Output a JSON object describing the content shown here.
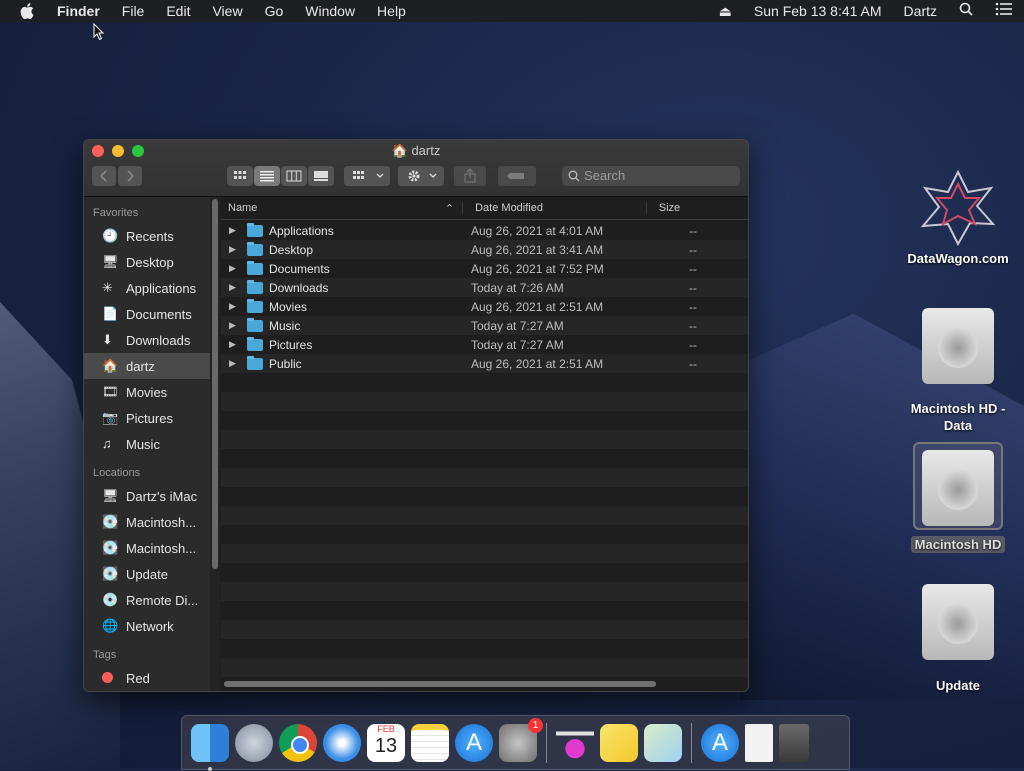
{
  "menubar": {
    "app_name": "Finder",
    "menus": [
      "File",
      "Edit",
      "View",
      "Go",
      "Window",
      "Help"
    ],
    "datetime": "Sun Feb 13  8:41 AM",
    "user": "Dartz"
  },
  "window": {
    "title": "dartz",
    "search_placeholder": "Search",
    "sidebar": {
      "favorites_heading": "Favorites",
      "favorites": [
        "Recents",
        "Desktop",
        "Applications",
        "Documents",
        "Downloads",
        "dartz",
        "Movies",
        "Pictures",
        "Music"
      ],
      "locations_heading": "Locations",
      "locations": [
        "Dartz's iMac",
        "Macintosh...",
        "Macintosh...",
        "Update",
        "Remote Di...",
        "Network"
      ],
      "tags_heading": "Tags",
      "tags": [
        "Red"
      ]
    },
    "columns": {
      "name": "Name",
      "date": "Date Modified",
      "size": "Size"
    },
    "rows": [
      {
        "name": "Applications",
        "date": "Aug 26, 2021 at 4:01 AM",
        "size": "--"
      },
      {
        "name": "Desktop",
        "date": "Aug 26, 2021 at 3:41 AM",
        "size": "--"
      },
      {
        "name": "Documents",
        "date": "Aug 26, 2021 at 7:52 PM",
        "size": "--"
      },
      {
        "name": "Downloads",
        "date": "Today at 7:26 AM",
        "size": "--"
      },
      {
        "name": "Movies",
        "date": "Aug 26, 2021 at 2:51 AM",
        "size": "--"
      },
      {
        "name": "Music",
        "date": "Today at 7:27 AM",
        "size": "--"
      },
      {
        "name": "Pictures",
        "date": "Today at 7:27 AM",
        "size": "--"
      },
      {
        "name": "Public",
        "date": "Aug 26, 2021 at 2:51 AM",
        "size": "--"
      }
    ]
  },
  "desktop_icons": [
    "DataWagon.com",
    "Macintosh HD - Data",
    "Macintosh HD",
    "Update"
  ],
  "dock": {
    "calendar_month": "FEB",
    "calendar_day": "13",
    "badge": "1"
  },
  "colors": {
    "accent": "#4aa8d8",
    "close": "#ff5f57",
    "minimize": "#febc2e",
    "zoom": "#28c840"
  }
}
